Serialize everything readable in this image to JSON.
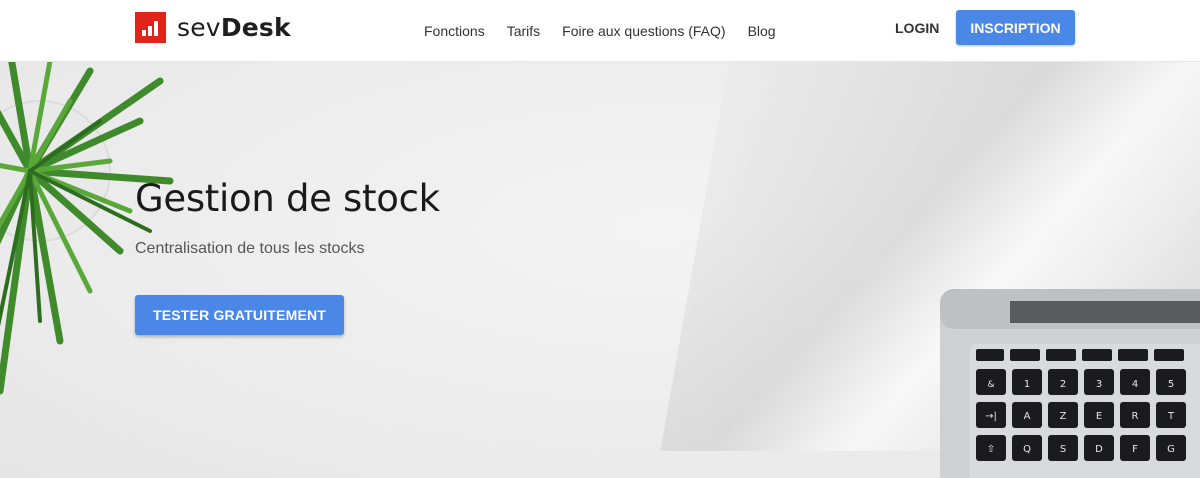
{
  "brand": {
    "name_regular": "sev",
    "name_bold": "Desk",
    "color": "#e2231a"
  },
  "nav": {
    "items": [
      {
        "label": "Fonctions"
      },
      {
        "label": "Tarifs"
      },
      {
        "label": "Foire aux questions (FAQ)"
      },
      {
        "label": "Blog"
      }
    ],
    "login": "LOGIN",
    "signup": "INSCRIPTION"
  },
  "hero": {
    "title": "Gestion de stock",
    "subtitle": "Centralisation de tous les stocks",
    "cta": "TESTER GRATUITEMENT"
  },
  "keyboard": {
    "row_numbers": [
      "1",
      "2",
      "3",
      "4",
      "5"
    ],
    "row_letters": [
      "A",
      "Z",
      "E",
      "R",
      "T"
    ],
    "row_home": [
      "Q",
      "S",
      "D",
      "F",
      "G"
    ]
  },
  "colors": {
    "accent": "#4a87e6",
    "text": "#1a1a1a"
  }
}
